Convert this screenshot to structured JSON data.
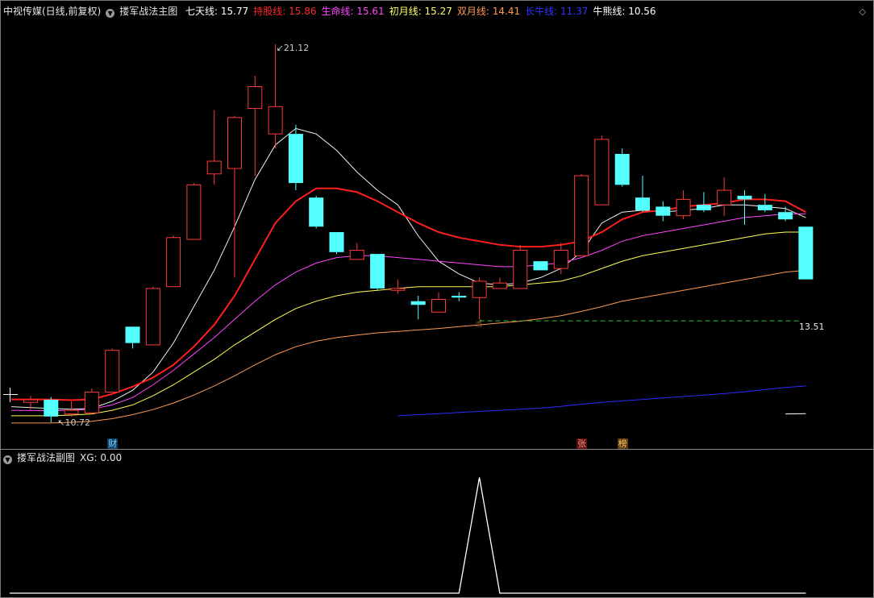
{
  "main_header": {
    "stock": "中视传媒(日线,前复权)",
    "indicator": "搂军战法主图",
    "lines": [
      {
        "label": "七天线: 15.77",
        "color": "#ffffff"
      },
      {
        "label": "持股线: 15.86",
        "color": "#ff2a2a"
      },
      {
        "label": "生命线: 15.61",
        "color": "#ff44ff"
      },
      {
        "label": "初月线: 15.27",
        "color": "#ffff66"
      },
      {
        "label": "双月线: 14.41",
        "color": "#ff9955"
      },
      {
        "label": "长牛线: 11.37",
        "color": "#3333ff"
      },
      {
        "label": "牛熊线: 10.56",
        "color": "#ffffff"
      }
    ]
  },
  "sub_header": {
    "indicator": "搂军战法副图",
    "value": "XG: 0.00"
  },
  "icons": {
    "collapse": "chevron-down-icon",
    "corner": "diamond-icon",
    "cursor": "hand-pointer-icon"
  },
  "markers": {
    "cai": "财",
    "zhang": "张",
    "bang": "榜"
  },
  "annotations": {
    "high": "21.12",
    "low": "10.72",
    "support": "13.51"
  },
  "chart_data": [
    {
      "type": "candlestick",
      "candles": [
        {
          "o": 11.27,
          "h": 11.45,
          "l": 11.06,
          "c": 11.34
        },
        {
          "o": 11.34,
          "h": 11.42,
          "l": 10.72,
          "c": 10.88
        },
        {
          "o": 10.95,
          "h": 11.3,
          "l": 10.88,
          "c": 11.05
        },
        {
          "o": 10.98,
          "h": 11.65,
          "l": 10.95,
          "c": 11.55
        },
        {
          "o": 11.55,
          "h": 12.75,
          "l": 11.55,
          "c": 12.7
        },
        {
          "o": 13.35,
          "h": 13.35,
          "l": 12.75,
          "c": 12.9
        },
        {
          "o": 12.85,
          "h": 14.45,
          "l": 12.85,
          "c": 14.4
        },
        {
          "o": 14.45,
          "h": 15.85,
          "l": 14.45,
          "c": 15.8
        },
        {
          "o": 15.75,
          "h": 17.3,
          "l": 15.75,
          "c": 17.25
        },
        {
          "o": 17.55,
          "h": 19.3,
          "l": 17.25,
          "c": 17.9
        },
        {
          "o": 17.7,
          "h": 19.15,
          "l": 14.7,
          "c": 19.1
        },
        {
          "o": 19.35,
          "h": 20.25,
          "l": 17.5,
          "c": 19.95
        },
        {
          "o": 18.65,
          "h": 21.12,
          "l": 18.25,
          "c": 19.4
        },
        {
          "o": 18.65,
          "h": 18.9,
          "l": 17.1,
          "c": 17.3
        },
        {
          "o": 16.9,
          "h": 16.95,
          "l": 16.05,
          "c": 16.1
        },
        {
          "o": 15.95,
          "h": 15.95,
          "l": 15.35,
          "c": 15.4
        },
        {
          "o": 15.2,
          "h": 15.65,
          "l": 15.2,
          "c": 15.45
        },
        {
          "o": 15.35,
          "h": 15.35,
          "l": 14.35,
          "c": 14.4
        },
        {
          "o": 14.35,
          "h": 14.65,
          "l": 14.25,
          "c": 14.4
        },
        {
          "o": 14.05,
          "h": 14.2,
          "l": 13.55,
          "c": 13.95
        },
        {
          "o": 13.75,
          "h": 14.3,
          "l": 13.75,
          "c": 14.1
        },
        {
          "o": 14.2,
          "h": 14.3,
          "l": 14.05,
          "c": 14.15
        },
        {
          "o": 14.15,
          "h": 14.7,
          "l": 13.55,
          "c": 14.6
        },
        {
          "o": 14.4,
          "h": 14.7,
          "l": 14.4,
          "c": 14.55
        },
        {
          "o": 14.4,
          "h": 15.6,
          "l": 14.4,
          "c": 15.45
        },
        {
          "o": 15.15,
          "h": 15.15,
          "l": 14.9,
          "c": 14.9
        },
        {
          "o": 14.95,
          "h": 15.65,
          "l": 14.8,
          "c": 15.45
        },
        {
          "o": 15.3,
          "h": 17.55,
          "l": 15.3,
          "c": 17.5
        },
        {
          "o": 16.7,
          "h": 18.6,
          "l": 16.7,
          "c": 18.5
        },
        {
          "o": 18.1,
          "h": 18.25,
          "l": 17.2,
          "c": 17.25
        },
        {
          "o": 16.9,
          "h": 17.5,
          "l": 16.5,
          "c": 16.55
        },
        {
          "o": 16.65,
          "h": 16.8,
          "l": 16.25,
          "c": 16.4
        },
        {
          "o": 16.4,
          "h": 17.1,
          "l": 16.3,
          "c": 16.85
        },
        {
          "o": 16.7,
          "h": 17.05,
          "l": 16.5,
          "c": 16.55
        },
        {
          "o": 16.7,
          "h": 17.45,
          "l": 16.4,
          "c": 17.1
        },
        {
          "o": 16.95,
          "h": 17.1,
          "l": 16.15,
          "c": 16.85
        },
        {
          "o": 16.7,
          "h": 17.0,
          "l": 16.5,
          "c": 16.55
        },
        {
          "o": 16.5,
          "h": 16.65,
          "l": 16.25,
          "c": 16.3
        },
        {
          "o": 16.1,
          "h": 16.1,
          "l": 14.65,
          "c": 14.65
        }
      ],
      "lines": [
        {
          "label": "七天线",
          "color": "#f0f0f0",
          "width": 1,
          "values": [
            11.15,
            11.1,
            11.08,
            11.1,
            11.3,
            11.6,
            12.1,
            12.9,
            13.9,
            14.9,
            16.1,
            17.4,
            18.35,
            18.8,
            18.65,
            18.2,
            17.6,
            17.1,
            16.7,
            15.85,
            15.15,
            14.8,
            14.55,
            14.5,
            14.55,
            14.7,
            14.95,
            15.4,
            16.2,
            16.5,
            16.55,
            16.5,
            16.55,
            16.6,
            16.7,
            16.7,
            16.65,
            16.6,
            16.35
          ]
        },
        {
          "label": "持股线",
          "color": "#ff1e1e",
          "width": 2,
          "values": [
            11.35,
            11.35,
            11.33,
            11.35,
            11.5,
            11.7,
            11.95,
            12.3,
            12.8,
            13.4,
            14.2,
            15.2,
            16.2,
            16.8,
            17.15,
            17.15,
            17.05,
            16.8,
            16.5,
            16.2,
            15.95,
            15.8,
            15.7,
            15.6,
            15.55,
            15.55,
            15.6,
            15.7,
            15.95,
            16.3,
            16.5,
            16.55,
            16.65,
            16.7,
            16.75,
            16.85,
            16.85,
            16.8,
            16.5
          ]
        },
        {
          "label": "生命线",
          "color": "#ff44ff",
          "width": 1,
          "values": [
            11.05,
            11.04,
            11.05,
            11.08,
            11.2,
            11.4,
            11.75,
            12.15,
            12.6,
            13.05,
            13.55,
            14.05,
            14.5,
            14.85,
            15.1,
            15.25,
            15.3,
            15.3,
            15.25,
            15.2,
            15.15,
            15.1,
            15.05,
            15.0,
            15.0,
            15.05,
            15.1,
            15.25,
            15.45,
            15.7,
            15.85,
            15.95,
            16.05,
            16.15,
            16.25,
            16.35,
            16.4,
            16.45,
            16.45
          ]
        },
        {
          "label": "初月线",
          "color": "#ffff55",
          "width": 1,
          "values": [
            10.9,
            10.9,
            10.92,
            10.95,
            11.05,
            11.2,
            11.45,
            11.75,
            12.1,
            12.45,
            12.85,
            13.2,
            13.55,
            13.85,
            14.05,
            14.2,
            14.3,
            14.35,
            14.4,
            14.45,
            14.45,
            14.45,
            14.45,
            14.45,
            14.5,
            14.55,
            14.6,
            14.75,
            14.95,
            15.15,
            15.3,
            15.4,
            15.5,
            15.6,
            15.7,
            15.8,
            15.9,
            15.95,
            15.95
          ]
        },
        {
          "label": "双月线",
          "color": "#ff9955",
          "width": 1,
          "values": [
            10.7,
            10.7,
            10.72,
            10.75,
            10.82,
            10.93,
            11.07,
            11.25,
            11.47,
            11.72,
            12.0,
            12.3,
            12.58,
            12.8,
            12.95,
            13.05,
            13.12,
            13.18,
            13.22,
            13.26,
            13.3,
            13.35,
            13.4,
            13.45,
            13.5,
            13.57,
            13.65,
            13.77,
            13.9,
            14.05,
            14.15,
            14.25,
            14.35,
            14.45,
            14.55,
            14.65,
            14.75,
            14.85,
            14.9
          ]
        },
        {
          "label": "长牛线",
          "color": "#2b2bff",
          "width": 1,
          "start": 18,
          "values": [
            10.9,
            10.93,
            10.96,
            10.99,
            11.02,
            11.05,
            11.08,
            11.11,
            11.16,
            11.22,
            11.27,
            11.31,
            11.35,
            11.39,
            11.43,
            11.47,
            11.51,
            11.56,
            11.62,
            11.68,
            11.72
          ]
        },
        {
          "label": "牛熊线",
          "color": "#ffffff",
          "width": 1,
          "start": 37,
          "values": [
            10.95,
            10.96
          ]
        }
      ],
      "support_line": {
        "value": 13.51,
        "from": 22,
        "color": "#2fbf2f"
      },
      "ylim": [
        10.1,
        21.8
      ]
    },
    {
      "type": "line",
      "series": [
        {
          "label": "XG",
          "color": "#ffffff",
          "values": [
            0,
            0,
            0,
            0,
            0,
            0,
            0,
            0,
            0,
            0,
            0,
            0,
            0,
            0,
            0,
            0,
            0,
            0,
            0,
            0,
            0,
            0,
            1,
            0,
            0,
            0,
            0,
            0,
            0,
            0,
            0,
            0,
            0,
            0,
            0,
            0,
            0,
            0,
            0
          ]
        }
      ],
      "ylim": [
        0,
        1.1
      ]
    }
  ]
}
